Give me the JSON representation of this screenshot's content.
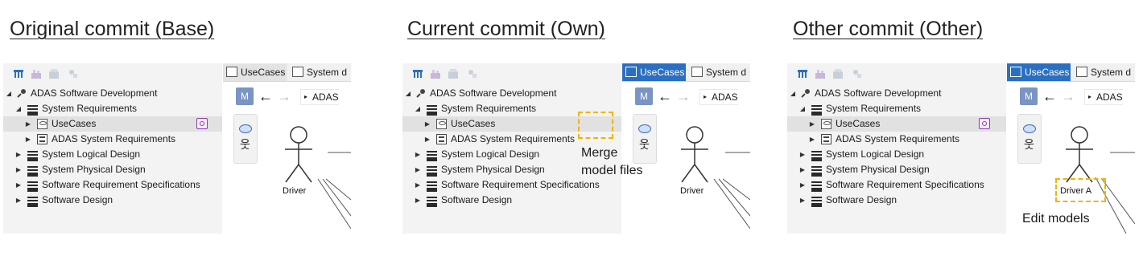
{
  "headings": {
    "base": "Original commit (Base)",
    "own": "Current commit (Own)",
    "other": "Other commit (Other)"
  },
  "tree": {
    "root": "ADAS Software Development",
    "system_requirements": "System Requirements",
    "use_cases": "UseCases",
    "adas_requirements": "ADAS System Requirements",
    "logical_design": "System Logical Design",
    "physical_design": "System Physical Design",
    "software_req_specs": "Software Requirement Specifications",
    "software_design": "Software Design"
  },
  "toolbar_icons": [
    "model-browser-icon",
    "diagram-icon",
    "package-icon",
    "pin-icon"
  ],
  "diagram": {
    "tab_usecases": "UseCases",
    "tab_system": "System d",
    "mode_button": "M",
    "back": "←",
    "forward": "→",
    "breadcrumb": "ADAS",
    "actor_base": "Driver",
    "actor_own": "Driver",
    "actor_other": "Driver A"
  },
  "annotations": {
    "merge": "Merge\nmodel files",
    "edit": "Edit models"
  },
  "colors": {
    "accent_blue": "#2b6fc2",
    "highlight_dash": "#f0b400",
    "selected_row": "#e1e1e1"
  }
}
